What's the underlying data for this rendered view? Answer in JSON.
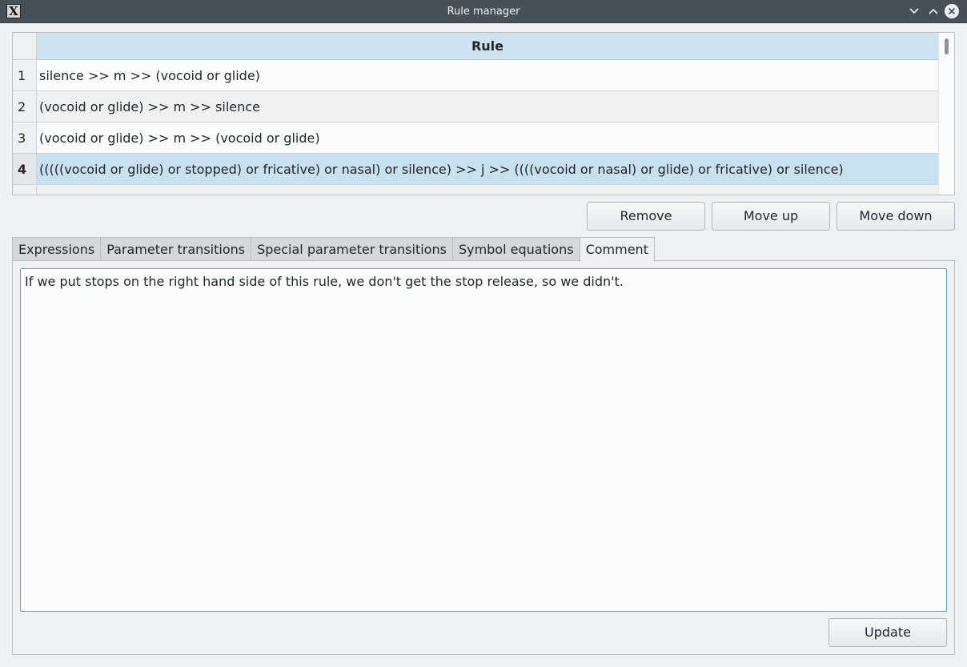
{
  "window": {
    "title": "Rule manager",
    "app_icon": "X",
    "controls": [
      "minimize-chevron-icon",
      "maximize-chevron-icon",
      "close-icon"
    ]
  },
  "table": {
    "header": "Rule",
    "rows": [
      {
        "number": "1",
        "rule": "silence >> m >> (vocoid or glide)"
      },
      {
        "number": "2",
        "rule": "(vocoid or glide) >> m >> silence"
      },
      {
        "number": "3",
        "rule": "(vocoid or glide) >> m >> (vocoid or glide)"
      },
      {
        "number": "4",
        "rule": "(((((vocoid or glide) or stopped) or fricative) or nasal) or silence) >> j >> ((((vocoid or nasal) or glide) or fricative) or silence)"
      }
    ],
    "selected_row": "4"
  },
  "buttons": {
    "remove": "Remove",
    "move_up": "Move up",
    "move_down": "Move down",
    "update": "Update"
  },
  "tabs": [
    {
      "label": "Expressions"
    },
    {
      "label": "Parameter transitions"
    },
    {
      "label": "Special parameter transitions"
    },
    {
      "label": "Symbol equations"
    },
    {
      "label": "Comment"
    }
  ],
  "active_tab": "Comment",
  "comment": {
    "text": "If we put stops on the right hand side of this rule, we don't get the stop release, so we didn't."
  },
  "colors": {
    "titlebar": "#475057",
    "header": "#cde4f0",
    "selection": "#c8e1f0",
    "focus": "#3daee9"
  }
}
